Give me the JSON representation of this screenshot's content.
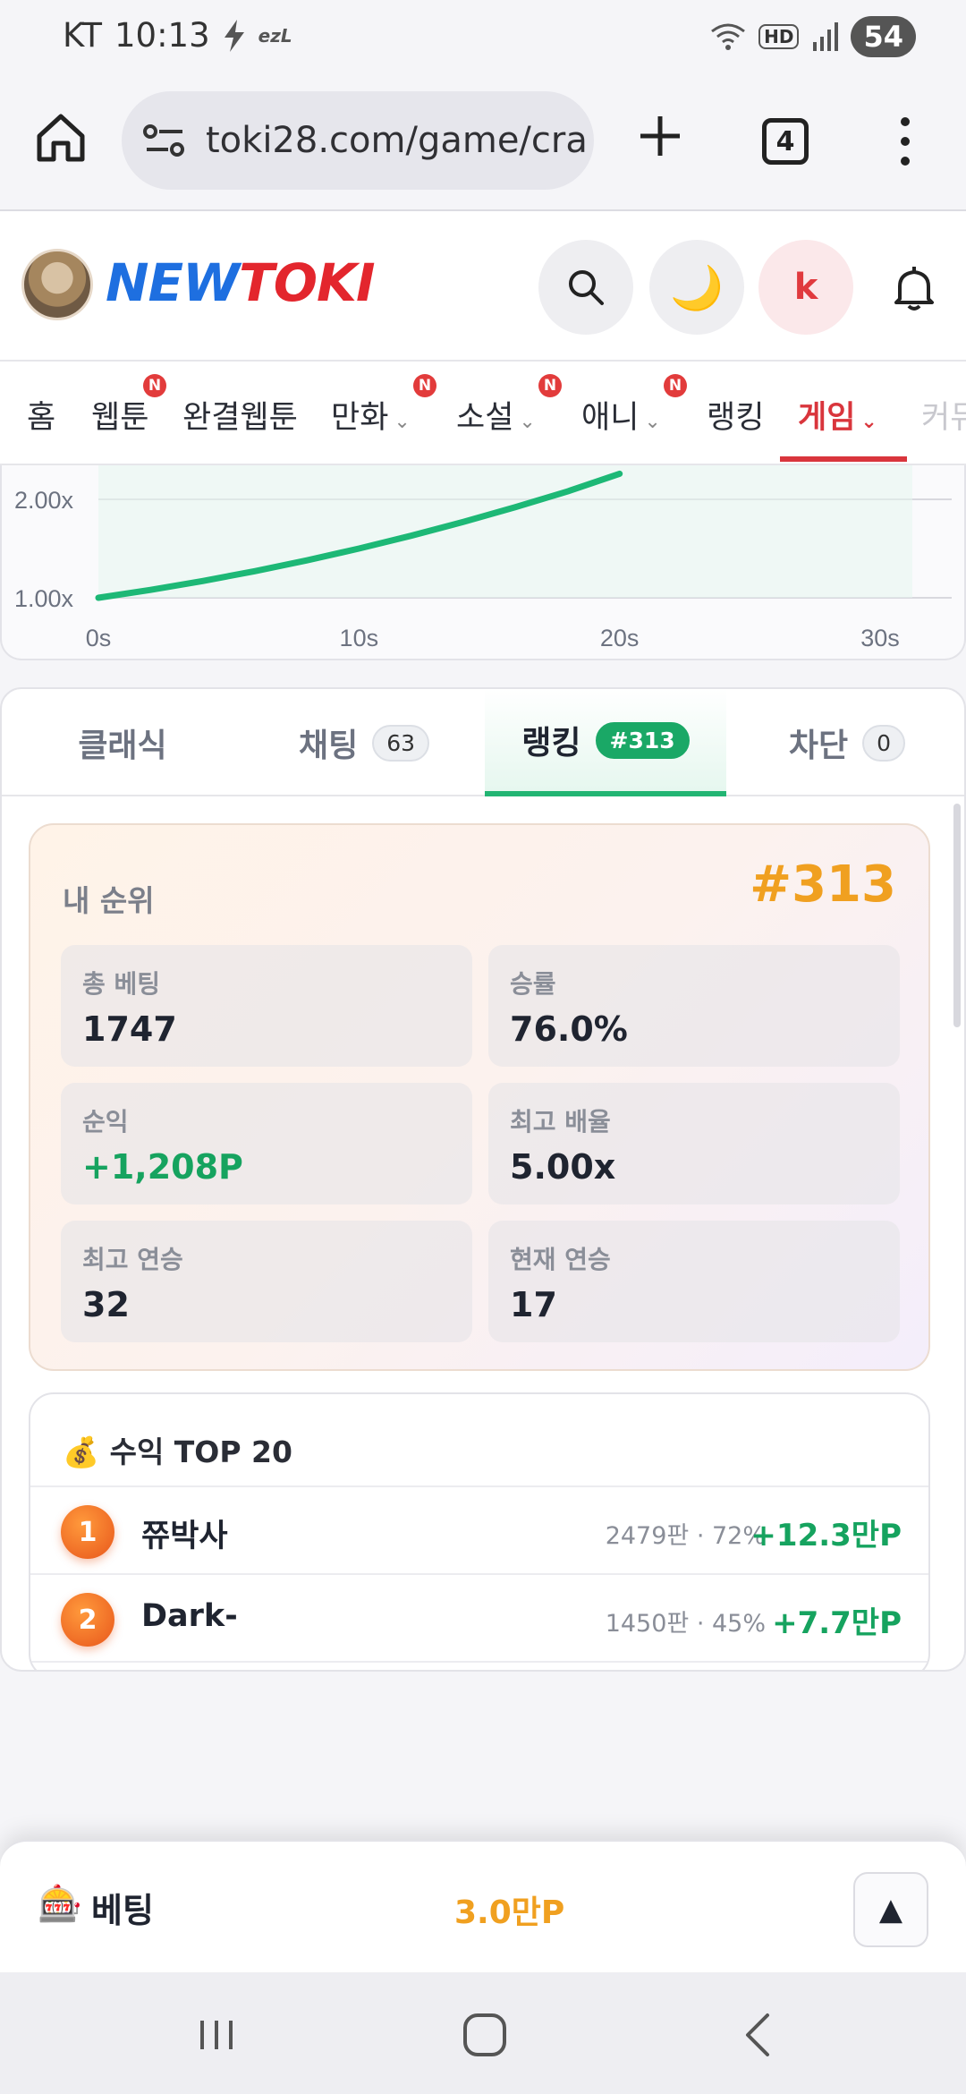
{
  "status": {
    "carrier": "KT",
    "time": "10:13",
    "extra": "ezL",
    "hd": "HD",
    "battery": "54"
  },
  "browser": {
    "url": "toki28.com/game/cra",
    "tab_count": "4"
  },
  "site": {
    "logo_part1": "NEW",
    "logo_part2": "TOKI",
    "avatar_letter": "k",
    "moon_glyph": "🌙"
  },
  "nav": {
    "items": [
      {
        "label": "홈"
      },
      {
        "label": "웹툰",
        "badge": "N"
      },
      {
        "label": "완결웹툰"
      },
      {
        "label": "만화",
        "badge": "N"
      },
      {
        "label": "소설",
        "badge": "N"
      },
      {
        "label": "애니",
        "badge": "N"
      },
      {
        "label": "랭킹"
      },
      {
        "label": "게임"
      },
      {
        "label": "커뮤"
      }
    ],
    "chevron": "⌄"
  },
  "chart_data": {
    "type": "line",
    "title": "",
    "xlabel": "",
    "ylabel": "",
    "x_ticks": [
      "0s",
      "10s",
      "20s",
      "30s"
    ],
    "y_ticks": [
      "1.00x",
      "2.00x"
    ],
    "x": [
      0,
      2,
      4,
      6,
      8,
      10,
      12,
      14,
      16,
      18,
      20
    ],
    "y": [
      1.0,
      1.08,
      1.17,
      1.27,
      1.38,
      1.5,
      1.63,
      1.77,
      1.92,
      2.08,
      2.26
    ],
    "xlim": [
      0,
      30
    ],
    "ylim": [
      1.0,
      2.0
    ],
    "color": "#1db876",
    "grid": true
  },
  "tabs": [
    {
      "label": "클래식",
      "badge": ""
    },
    {
      "label": "채팅",
      "badge": "63"
    },
    {
      "label": "랭킹",
      "badge": "#313"
    },
    {
      "label": "차단",
      "badge": "0"
    }
  ],
  "my_rank": {
    "label": "내 순위",
    "rank": "#313",
    "stats": [
      {
        "label": "총 베팅",
        "value": "1747"
      },
      {
        "label": "승률",
        "value": "76.0%"
      },
      {
        "label": "순익",
        "value": "+1,208P"
      },
      {
        "label": "최고 배율",
        "value": "5.00x"
      },
      {
        "label": "최고 연승",
        "value": "32"
      },
      {
        "label": "현재 연승",
        "value": "17"
      }
    ]
  },
  "top20": {
    "title": "💰 수익 TOP 20",
    "rows": [
      {
        "rank": "1",
        "name": "쮸박사",
        "meta": "2479판 · 72%",
        "profit": "+12.3만P"
      },
      {
        "rank": "2",
        "name": "Dark-",
        "meta": "1450판 · 45%",
        "profit": "+7.7만P"
      }
    ]
  },
  "bet": {
    "emoji": "🎰",
    "label": "베팅",
    "amount": "3.0만P",
    "toggle_glyph": "▲"
  }
}
